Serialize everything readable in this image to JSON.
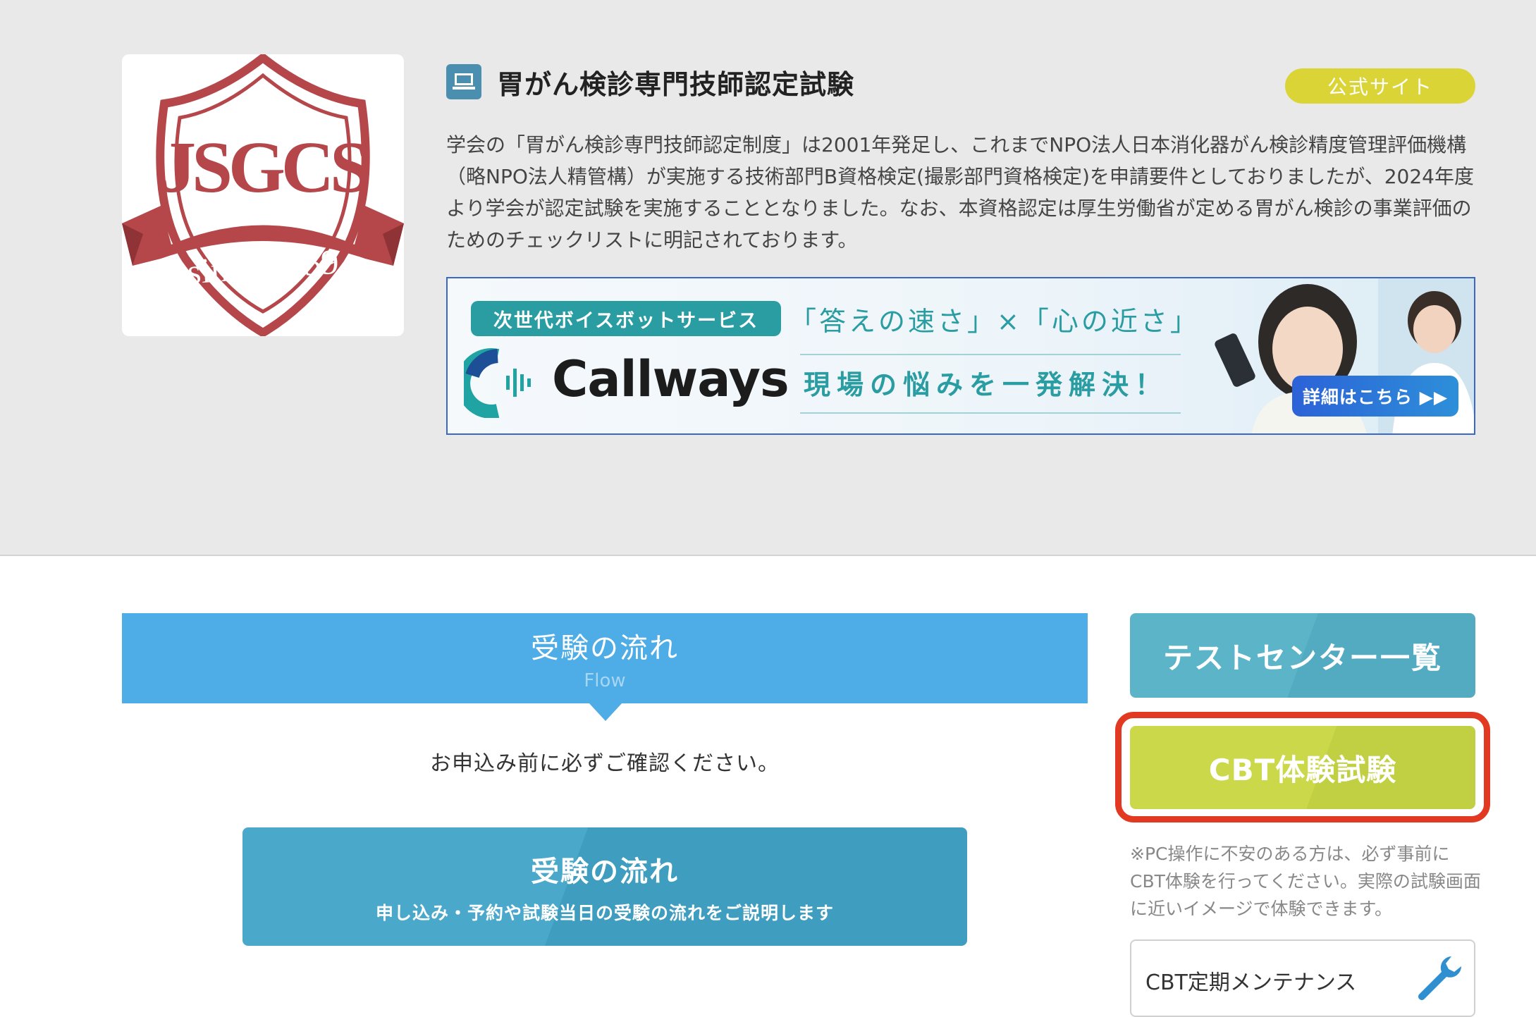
{
  "exam": {
    "title": "胃がん検診専門技師認定試験",
    "icon": "computer-icon",
    "official_site_label": "公式サイト",
    "description": "学会の「胃がん検診専門技師認定制度」は2001年発足し、これまでNPO法人日本消化器がん検診精度管理評価機構（略NPO法人精管構）が実施する技術部門B資格検定(撮影部門資格検定)を申請要件としておりましたが、2024年度より学会が認定試験を実施することとなりました。なお、本資格認定は厚生労働省が定める胃がん検診の事業評価のためのチェックリストに明記されております。"
  },
  "logo": {
    "main_text": "JSGCS",
    "ribbon_text": "since 1959",
    "color": "#b5474a"
  },
  "ad": {
    "tag": "次世代ボイスボットサービス",
    "catchphrase": "「答えの速さ」×「心の近さ」",
    "brand": "Callways",
    "subcopy": "現場の悩みを一発解決！",
    "detail_button": "詳細はこちら ▶▶"
  },
  "flow_section": {
    "header_title": "受験の流れ",
    "header_sub": "Flow",
    "notice": "お申込み前に必ずご確認ください。",
    "button_title": "受験の流れ",
    "button_sub": "申し込み・予約や試験当日の受験の流れをご説明します"
  },
  "sidebar": {
    "test_center_button": "テストセンター一覧",
    "cbt_button": "CBT体験試験",
    "cbt_note": "※PC操作に不安のある方は、必ず事前にCBT体験を行ってください。実際の試験画面に近いイメージで体験できます。",
    "maintenance_label": "CBT定期メンテナンス",
    "maintenance_icon": "wrench-icon"
  },
  "colors": {
    "flow_header": "#4eace6",
    "flow_button": "#4aa9cb",
    "test_center": "#5cb4c9",
    "cbt": "#cad84a",
    "highlight": "#e23a22",
    "official_badge": "#dbd437"
  }
}
